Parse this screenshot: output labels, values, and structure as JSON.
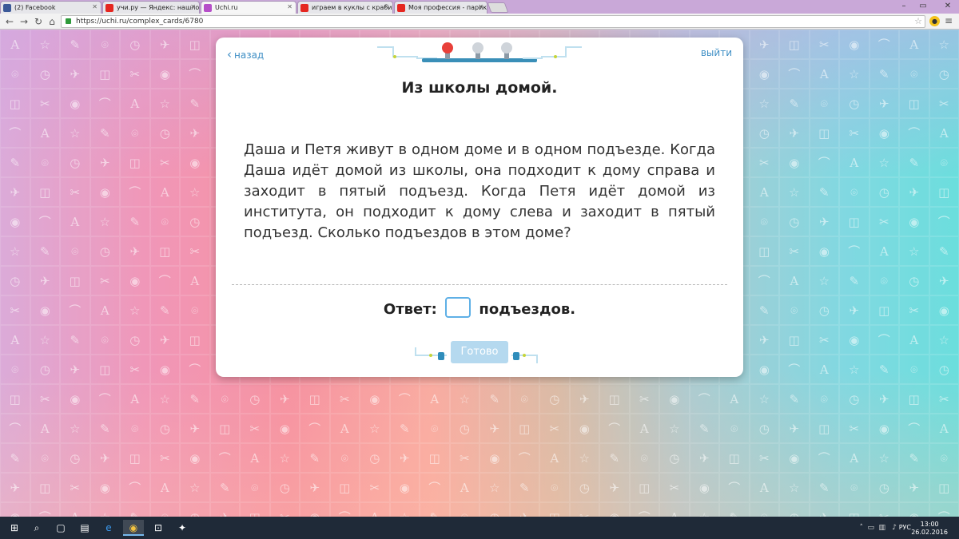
{
  "browser": {
    "tabs": [
      {
        "title": "(2) Facebook",
        "favicon_color": "#3b5998",
        "active": false
      },
      {
        "title": "учи.ру — Яндекс: нашлос",
        "favicon_color": "#e52620",
        "active": false
      },
      {
        "title": "Uchi.ru",
        "favicon_color": "#b64fc9",
        "active": true
      },
      {
        "title": "играем в куклы с крабик",
        "favicon_color": "#e52620",
        "active": false
      },
      {
        "title": "Моя профессия - парикм",
        "favicon_color": "#e52620",
        "active": false
      }
    ],
    "url": "https://uchi.ru/complex_cards/6780"
  },
  "card": {
    "back_label": "назад",
    "exit_label": "выйти",
    "title": "Из школы домой.",
    "problem_text": "Даша и Петя живут в одном доме и в одном подъезде. Когда Даша идёт домой из школы, она подходит к дому справа и заходит в пятый подъезд. Когда Петя идёт домой из института, он подходит к дому слева и заходит в пятый подъезд. Сколько подъездов в этом доме?",
    "answer_prefix": "Ответ:",
    "answer_suffix": "подъездов.",
    "answer_value": "",
    "done_label": "Готово",
    "progress": {
      "total": 3,
      "current": 1,
      "current_color": "#e8403a",
      "other_color": "#cfd4da"
    }
  },
  "taskbar": {
    "language": "РУС",
    "time": "13:00",
    "date": "26.02.2016"
  },
  "colors": {
    "accent": "#3f8fc5",
    "input_border": "#5fb0e6",
    "button_disabled": "#b5d9ef"
  }
}
